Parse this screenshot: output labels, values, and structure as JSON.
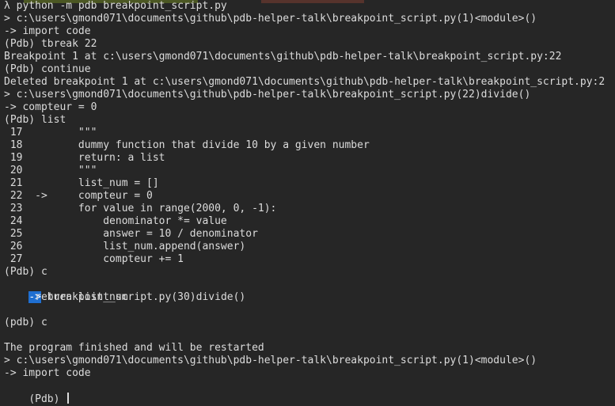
{
  "colors": {
    "background": "#262626",
    "text": "#dcdcdc",
    "highlight": "#1f6fd1"
  },
  "terminal": {
    "lines": [
      "λ python -m pdb breakpoint_script.py",
      "> c:\\users\\gmond071\\documents\\github\\pdb-helper-talk\\breakpoint_script.py(1)<module>()",
      "-> import code",
      "(Pdb) tbreak 22",
      "Breakpoint 1 at c:\\users\\gmond071\\documents\\github\\pdb-helper-talk\\breakpoint_script.py:22",
      "(Pdb) continue",
      "Deleted breakpoint 1 at c:\\users\\gmond071\\documents\\github\\pdb-helper-talk\\breakpoint_script.py:2",
      "> c:\\users\\gmond071\\documents\\github\\pdb-helper-talk\\breakpoint_script.py(22)divide()",
      "-> compteur = 0",
      "(Pdb) list",
      " 17         \"\"\"",
      " 18         dummy function that divide 10 by a given number",
      " 19         return: a list",
      " 20         \"\"\"",
      " 21         list_num = []",
      " 22  ->     compteur = 0",
      " 23         for value in range(2000, 0, -1):",
      " 24             denominator *= value",
      " 25             answer = 10 / denominator",
      " 26             list_num.append(answer)",
      " 27             compteur += 1",
      "(Pdb) c",
      "",
      "     return list_num",
      "",
      "(pdb) c",
      "",
      "The program finished and will be restarted",
      "> c:\\users\\gmond071\\documents\\github\\pdb-helper-talk\\breakpoint_script.py(1)<module>()",
      "-> import code",
      ""
    ],
    "current_arrow": "->",
    "current_location": " breakpoint_script.py(30)divide()",
    "prompt": "(Pdb) "
  }
}
